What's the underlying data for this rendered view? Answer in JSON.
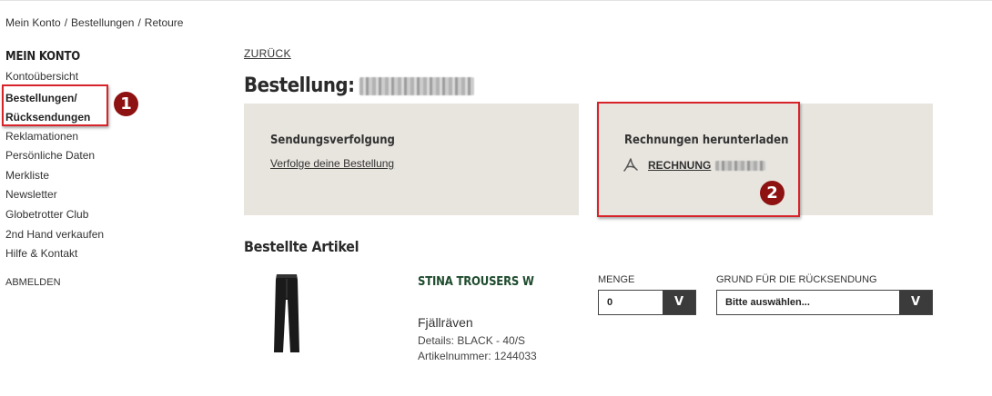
{
  "breadcrumb": {
    "items": [
      "Mein Konto",
      "Bestellungen",
      "Retoure"
    ],
    "separator": "/"
  },
  "sidebar": {
    "title": "MEIN KONTO",
    "items": [
      "Kontoübersicht",
      "Bestellungen/",
      "Rücksendungen",
      "Reklamationen",
      "Persönliche Daten",
      "Merkliste",
      "Newsletter",
      "Globetrotter Club",
      "2nd Hand verkaufen",
      "Hilfe & Kontakt"
    ],
    "logout": "ABMELDEN"
  },
  "annotations": {
    "badge1": "1",
    "badge2": "2",
    "highlight_color": "#d8232a",
    "badge_color": "#8e1212"
  },
  "main": {
    "back_label": "ZURÜCK",
    "order_label": "Bestellung:",
    "tracking": {
      "title": "Sendungsverfolgung",
      "link": "Verfolge deine Bestellung"
    },
    "invoice": {
      "title": "Rechnungen herunterladen",
      "link": "RECHNUNG",
      "icon": "pdf-icon"
    },
    "ordered_items_title": "Bestellte Artikel",
    "item": {
      "name": "STINA TROUSERS W",
      "brand": "Fjällräven",
      "details": "Details: BLACK - 40/S",
      "article_number": "Artikelnummer:  1244033"
    },
    "quantity": {
      "label": "MENGE",
      "value": "0",
      "arrow": "V"
    },
    "reason": {
      "label": "GRUND FÜR DIE RÜCKSENDUNG",
      "value": "Bitte auswählen...",
      "arrow": "V"
    }
  },
  "colors": {
    "panel": "#e8e5df",
    "product_name": "#1e4b2d",
    "select_button": "#3b3b3b"
  }
}
